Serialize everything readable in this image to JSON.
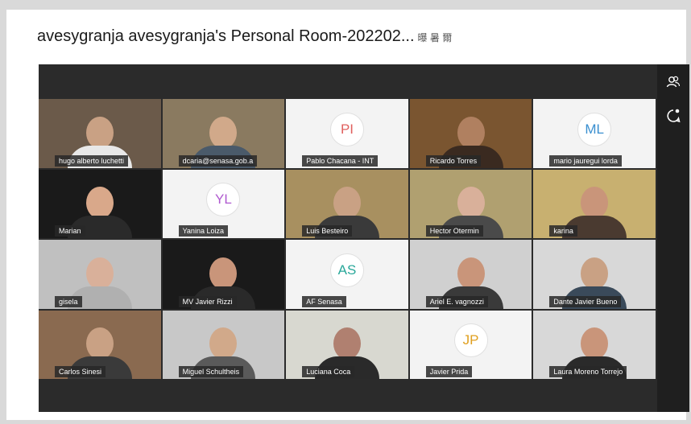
{
  "window": {
    "title": "avesygranja avesygranja's Personal Room-202202...",
    "title_tag": "曝 暑 爾"
  },
  "sidebar": {
    "participants_icon": "participants-icon",
    "chat_icon": "chat-icon"
  },
  "participants": [
    {
      "name": "hugo alberto luchetti",
      "type": "video",
      "bg": "#6b5a4a",
      "head": "#c9a184",
      "body": "#e8e8e8"
    },
    {
      "name": "dcaria@senasa.gob.a",
      "type": "video",
      "bg": "#8a7a60",
      "head": "#d1a98a",
      "body": "#4a5a6a"
    },
    {
      "name": "Pablo Chacana - INT",
      "type": "avatar",
      "initials": "PI",
      "color": "#e0605e"
    },
    {
      "name": "Ricardo Torres",
      "type": "video",
      "bg": "#7a5530",
      "head": "#b08060",
      "body": "#3a2a20"
    },
    {
      "name": "mario jauregui lorda",
      "type": "avatar",
      "initials": "ML",
      "color": "#3a8fd0"
    },
    {
      "name": "Marian",
      "type": "video",
      "bg": "#1a1a1a",
      "head": "#d9a88a",
      "body": "#2a2a2a"
    },
    {
      "name": "Yanina Loiza",
      "type": "avatar",
      "initials": "YL",
      "color": "#b05ad0"
    },
    {
      "name": "Luis Besteiro",
      "type": "video",
      "bg": "#a89060",
      "head": "#c9a184",
      "body": "#3a3a3a"
    },
    {
      "name": "Hector Otermin",
      "type": "video",
      "bg": "#b0a070",
      "head": "#d9b09a",
      "body": "#4a4a4a"
    },
    {
      "name": "karina",
      "type": "video",
      "bg": "#c8b070",
      "head": "#c9957a",
      "body": "#4a3a30"
    },
    {
      "name": "gisela",
      "type": "video",
      "bg": "#c0c0c0",
      "head": "#d9b09a",
      "body": "#b0b0b0"
    },
    {
      "name": "MV Javier Rizzi",
      "type": "video",
      "bg": "#1a1a1a",
      "head": "#c9957a",
      "body": "#2a2a2a"
    },
    {
      "name": "AF Senasa",
      "type": "avatar",
      "initials": "AS",
      "color": "#2aa89a"
    },
    {
      "name": "Ariel E. vagnozzi",
      "type": "video",
      "bg": "#d0d0d0",
      "head": "#c9957a",
      "body": "#3a3a3a"
    },
    {
      "name": "Dante Javier Bueno",
      "type": "video",
      "bg": "#d8d8d8",
      "head": "#c9a184",
      "body": "#3a4a5a"
    },
    {
      "name": "Carlos Sinesi",
      "type": "video",
      "bg": "#8a6a50",
      "head": "#c9a184",
      "body": "#3a3a3a"
    },
    {
      "name": "Miguel Schultheis",
      "type": "video",
      "bg": "#c8c8c8",
      "head": "#d1a98a",
      "body": "#5a5a5a"
    },
    {
      "name": "Luciana Coca",
      "type": "video",
      "bg": "#d8d8d0",
      "head": "#b08070",
      "body": "#2a2a2a"
    },
    {
      "name": "Javier Prida",
      "type": "avatar",
      "initials": "JP",
      "color": "#e0a020"
    },
    {
      "name": "Laura Moreno Torrejo",
      "type": "video",
      "bg": "#d8d8d8",
      "head": "#c9957a",
      "body": "#2a2a2a"
    }
  ]
}
